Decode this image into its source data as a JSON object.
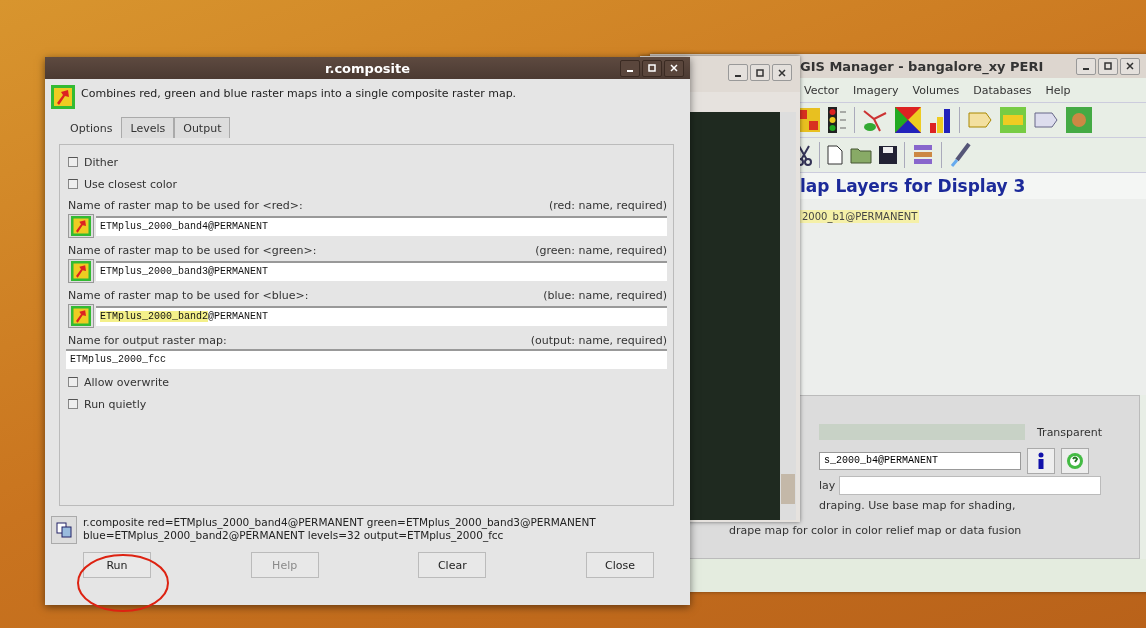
{
  "dialog": {
    "title": "r.composite",
    "description": "Combines red, green and blue raster maps into a single composite raster map.",
    "tabs": [
      {
        "label": "Options",
        "selected": true
      },
      {
        "label": "Levels",
        "selected": false
      },
      {
        "label": "Output",
        "selected": false
      }
    ],
    "options": [
      {
        "kind": "checkbox",
        "label": "Dither",
        "checked": false
      },
      {
        "kind": "checkbox",
        "label": "Use closest color",
        "checked": false
      },
      {
        "kind": "map_field",
        "label": "Name of raster map to be used for <red>:",
        "hint": "(red:  name, required)",
        "parts": [
          {
            "text": "ETMplus_2000_band4@PERMANENT",
            "selected": false
          }
        ]
      },
      {
        "kind": "map_field",
        "label": "Name of raster map to be used for <green>:",
        "hint": "(green:  name, required)",
        "parts": [
          {
            "text": "ETMplus_2000_band3@PERMANENT",
            "selected": false
          }
        ]
      },
      {
        "kind": "map_field",
        "label": "Name of raster map to be used for <blue>:",
        "hint": "(blue:  name, required)",
        "parts": [
          {
            "text": "ETMplus_2000_band2",
            "selected": true
          },
          {
            "text": "@PERMANENT",
            "selected": false
          }
        ]
      },
      {
        "kind": "text_field",
        "label": "Name for output raster map:",
        "hint": "(output:  name, required)",
        "parts": [
          {
            "text": "ETMplus_2000_fcc",
            "selected": false
          }
        ]
      },
      {
        "kind": "checkbox",
        "label": "Allow overwrite",
        "checked": false
      },
      {
        "kind": "checkbox",
        "label": "Run quietly",
        "checked": false
      }
    ],
    "command_lines": [
      "r.composite red=ETMplus_2000_band4@PERMANENT green=ETMplus_2000_band3@PERMANENT",
      "blue=ETMplus_2000_band2@PERMANENT levels=32 output=ETMplus_2000_fcc"
    ],
    "buttons": [
      {
        "label": "Run",
        "disabled": false
      },
      {
        "label": "Help",
        "disabled": true
      },
      {
        "label": "Clear",
        "disabled": false
      },
      {
        "label": "Close",
        "disabled": false
      }
    ]
  },
  "manager": {
    "title": "GIS Manager - bangalore_xy PERI",
    "menus": [
      "Vector",
      "Imagery",
      "Volumes",
      "Databases",
      "Help"
    ],
    "heading": "lap Layers for Display 3",
    "layers": [
      {
        "name": "2000_b1@PERMANENT",
        "selected": true
      }
    ],
    "opacity_label": "Transparent",
    "map_value": "s_2000_b4@PERMANENT",
    "field_label": "lay",
    "note_lines": [
      "draping. Use base map for shading,",
      "drape map for color in color relief map or data fusion"
    ]
  }
}
